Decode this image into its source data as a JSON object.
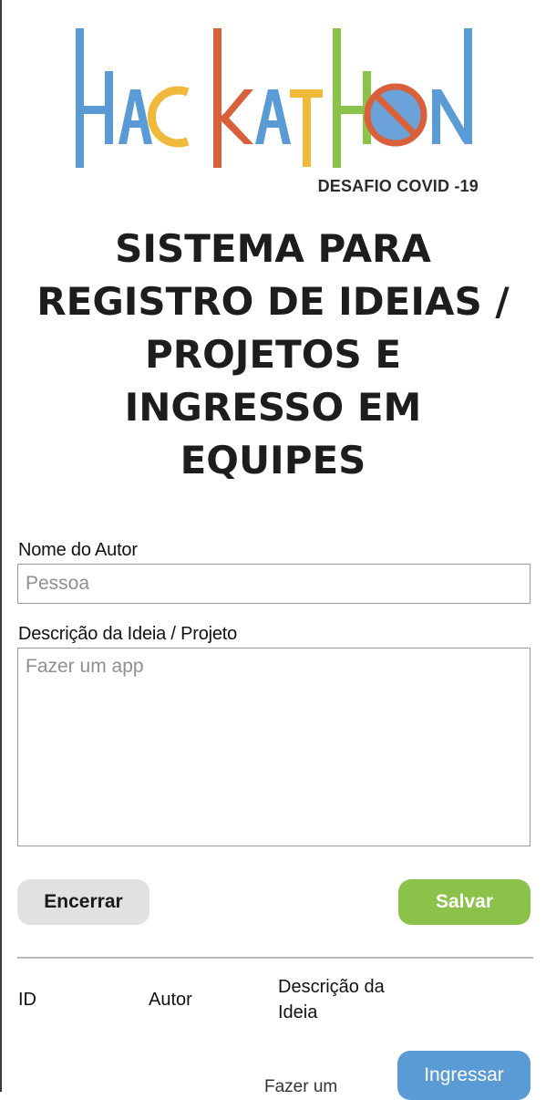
{
  "logo": {
    "text": "HACKATHON",
    "subtitle": "DESAFIO COVID -19",
    "colors": [
      "#5b9bd5",
      "#5b9bd5",
      "#f0b93a",
      "#d9603b",
      "#5b9bd5",
      "#f0b93a",
      "#8bc34a",
      "#d9603b",
      "#5b9bd5"
    ]
  },
  "title": {
    "lines": [
      "SISTEMA PARA",
      "REGISTRO DE IDEIAS /",
      "PROJETOS E",
      "INGRESSO EM",
      "EQUIPES"
    ]
  },
  "form": {
    "author_label": "Nome do Autor",
    "author_placeholder": "Pessoa",
    "description_label": "Descrição da Ideia / Projeto",
    "description_placeholder": "Fazer um app",
    "close_label": "Encerrar",
    "save_label": "Salvar"
  },
  "table": {
    "headers": [
      "ID",
      "Autor",
      "Descrição da Ideia"
    ],
    "rows": [
      {
        "id": "",
        "author": "",
        "description": "Fazer um",
        "action": "Ingressar"
      }
    ]
  },
  "colors": {
    "green": "#8bc34a",
    "blue": "#5b9bd5",
    "gray": "#e1e1e1",
    "orange": "#d9603b",
    "yellow": "#f0b93a"
  }
}
